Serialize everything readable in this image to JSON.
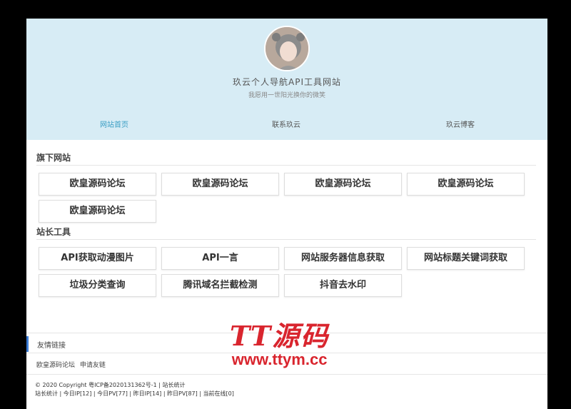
{
  "header": {
    "site_title": "玖云个人导航API工具网站",
    "motto": "我愿用一世阳光换你的微笑"
  },
  "nav": [
    "网站首页",
    "联系玖云",
    "玖云博客"
  ],
  "sections": {
    "sites_title": "旗下网站",
    "sites": [
      "欧皇源码论坛",
      "欧皇源码论坛",
      "欧皇源码论坛",
      "欧皇源码论坛",
      "欧皇源码论坛"
    ],
    "tools_title": "站长工具",
    "tools": [
      "API获取动漫图片",
      "API一言",
      "网站服务器信息获取",
      "网站标题关键词获取",
      "垃圾分类查询",
      "腾讯域名拦截检测",
      "抖音去水印"
    ]
  },
  "links": {
    "title": "友情链接",
    "items": [
      "欧皇源码论坛",
      "申请友链"
    ]
  },
  "footer": {
    "line1": "© 2020 Copyright   粤ICP备2020131362号-1 |   站长统计",
    "line2": "站长统计 | 今日IP[12] | 今日PV[77] | 昨日IP[14] | 昨日PV[87] | 当前在线[0]"
  },
  "watermark": {
    "logo": "TT源码",
    "url": "www.ttym.cc"
  },
  "colors": {
    "hero_bg": "#d7ecf5",
    "accent": "#3a9ec4",
    "watermark": "#d9252e"
  }
}
